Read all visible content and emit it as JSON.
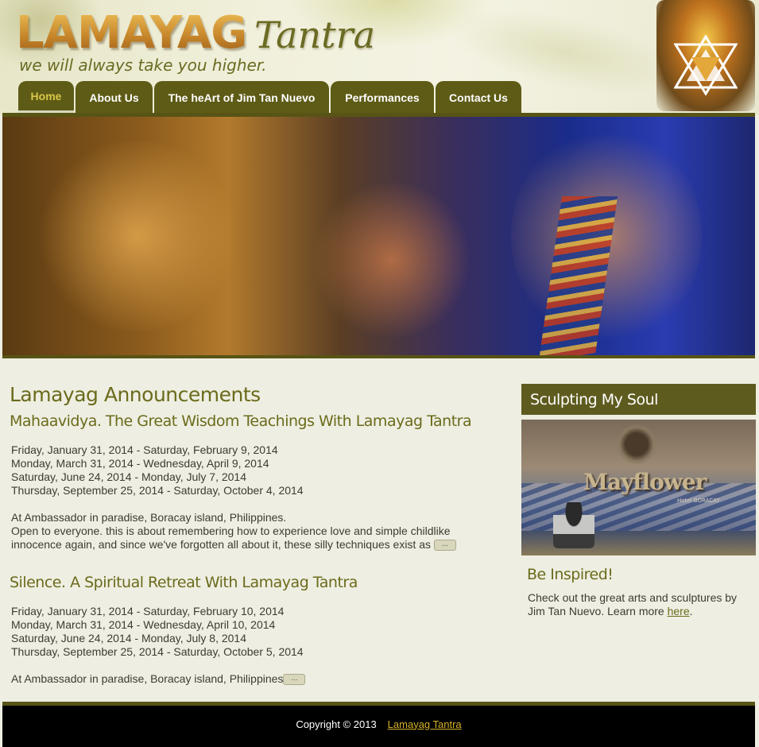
{
  "header": {
    "logo_main": "LAMAYAG",
    "logo_sub": "Tantra",
    "tagline": "we will always take you higher."
  },
  "nav": {
    "items": [
      {
        "label": "Home",
        "active": true
      },
      {
        "label": "About Us"
      },
      {
        "label": "The heArt of Jim Tan Nuevo"
      },
      {
        "label": "Performances"
      },
      {
        "label": "Contact Us"
      }
    ]
  },
  "main": {
    "title": "Lamayag Announcements",
    "events": [
      {
        "title": "Mahaavidya. The Great Wisdom Teachings With Lamayag Tantra",
        "dates": [
          "Friday, January 31, 2014 - Saturday, February 9, 2014",
          "Monday, March 31, 2014 - Wednesday, April 9, 2014",
          "Saturday, June 24, 2014 - Monday, July 7, 2014",
          "Thursday, September 25, 2014 - Saturday, October 4, 2014"
        ],
        "location": "At Ambassador in paradise, Boracay island, Philippines.",
        "description": "Open to everyone. this is about remembering how to experience love and simple childlike innocence again, and since we've forgotten all about it, these silly techniques exist as",
        "more_label": "..."
      },
      {
        "title": "Silence. A Spiritual Retreat With Lamayag Tantra",
        "dates": [
          "Friday, January 31, 2014 - Saturday, February 10, 2014",
          "Monday, March 31, 2014 - Wednesday, April 10, 2014",
          "Saturday, June 24, 2014 - Monday, July 8, 2014",
          "Thursday, September 25, 2014 - Saturday, October 5, 2014"
        ],
        "location": "At Ambassador in paradise, Boracay island, Philippines",
        "more_label": "..."
      }
    ]
  },
  "sidebar": {
    "heading": "Sculpting My Soul",
    "image_sign": "Mayflower",
    "image_sign_small": "Hotel   BORACAY",
    "subheading": "Be Inspired!",
    "text": "Check out the great arts and sculptures by Jim Tan Nuevo. Learn more ",
    "link_label": "here",
    "text_end": "."
  },
  "footer": {
    "copyright": "Copyright © 2013",
    "link_label": "Lamayag Tantra"
  },
  "colors": {
    "accent_dark": "#5e5b16",
    "title_olive": "#6b6b1c",
    "active_tab_text": "#d8c74a",
    "footer_link": "#d6b22a",
    "page_bg": "#eeeee2"
  }
}
